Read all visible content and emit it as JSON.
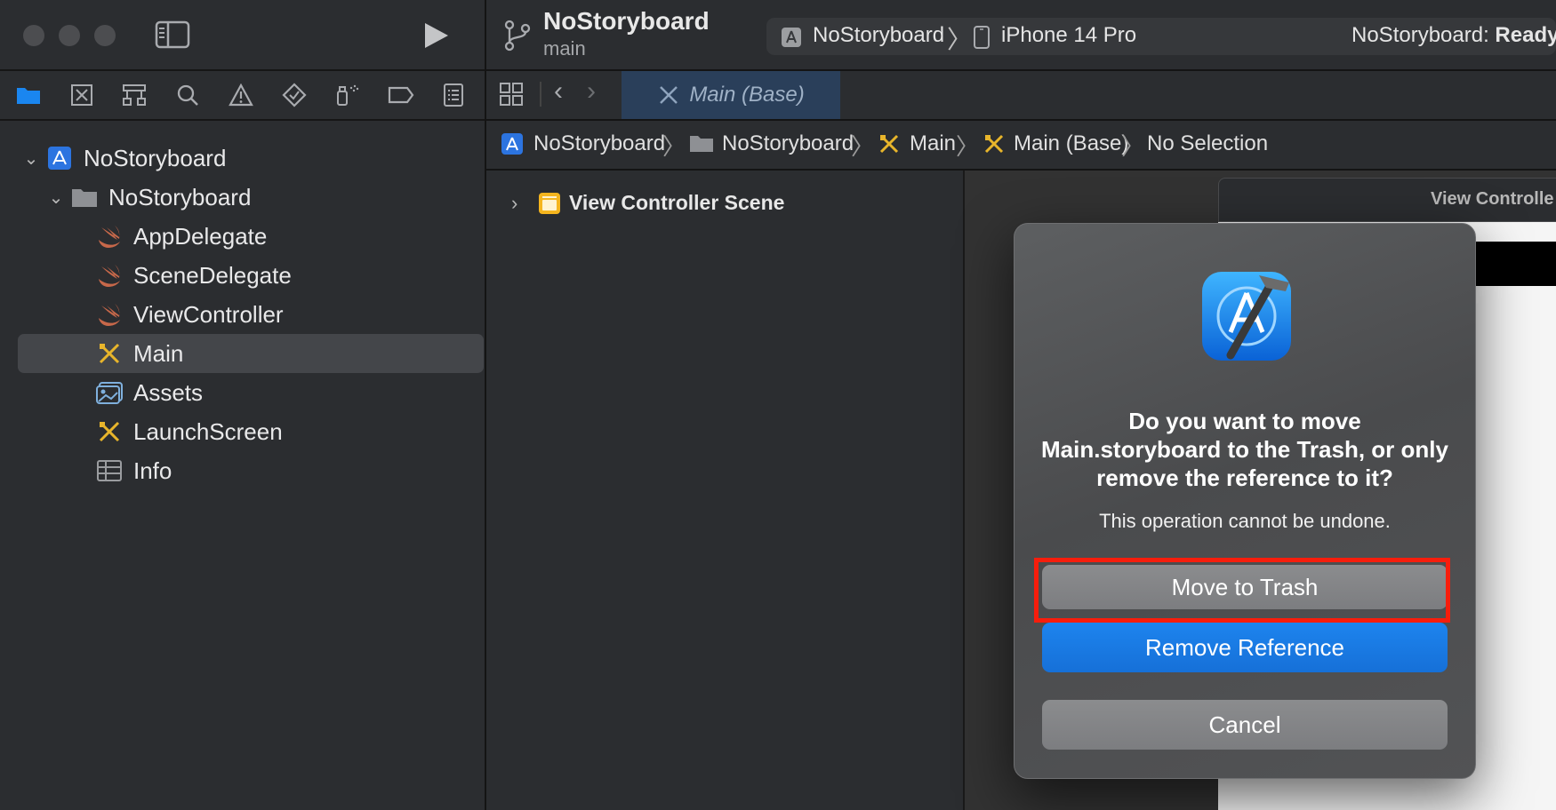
{
  "toolbar": {
    "project_name": "NoStoryboard",
    "branch": "main",
    "scheme": "NoStoryboard",
    "device": "iPhone 14 Pro",
    "status_prefix": "NoStoryboard: ",
    "status_value": "Ready"
  },
  "tab": {
    "label": "Main (Base)"
  },
  "jump_bar": {
    "items": [
      "NoStoryboard",
      "NoStoryboard",
      "Main",
      "Main (Base)",
      "No Selection"
    ]
  },
  "navigator": {
    "items": [
      {
        "label": "NoStoryboard",
        "icon": "app-project-icon"
      },
      {
        "label": "NoStoryboard",
        "icon": "folder-icon"
      },
      {
        "label": "AppDelegate",
        "icon": "swift-icon"
      },
      {
        "label": "SceneDelegate",
        "icon": "swift-icon"
      },
      {
        "label": "ViewController",
        "icon": "swift-icon"
      },
      {
        "label": "Main",
        "icon": "storyboard-icon"
      },
      {
        "label": "Assets",
        "icon": "assets-icon"
      },
      {
        "label": "LaunchScreen",
        "icon": "storyboard-icon"
      },
      {
        "label": "Info",
        "icon": "plist-icon"
      }
    ]
  },
  "outline": {
    "scene_label": "View Controller Scene"
  },
  "canvas": {
    "header_label": "View Controlle"
  },
  "dialog": {
    "title": "Do you want to move Main.storyboard to the Trash, or only remove the reference to it?",
    "message": "This operation cannot be undone.",
    "move_button": "Move to Trash",
    "remove_button": "Remove Reference",
    "cancel_button": "Cancel"
  },
  "colors": {
    "accent_blue": "#1a7ae6",
    "highlight_red": "#f71d0c",
    "storyboard_yellow": "#e8b52b",
    "swift_orange": "#c7684a"
  }
}
